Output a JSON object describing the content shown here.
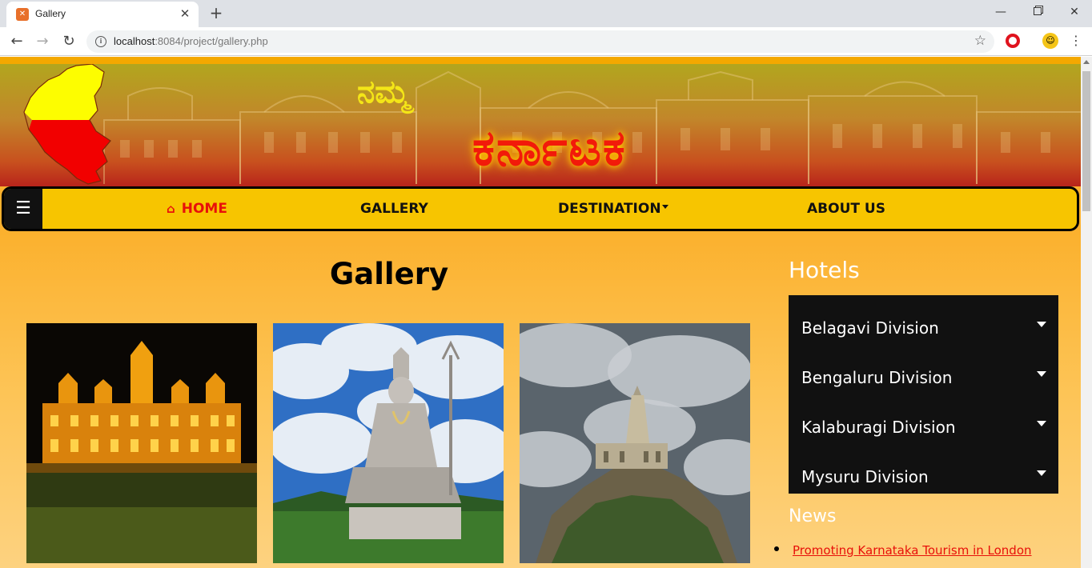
{
  "browser": {
    "tab_title": "Gallery",
    "tab_favicon": "xampp-icon",
    "url_host": "localhost",
    "url_rest": ":8084/project/gallery.php"
  },
  "site": {
    "logo_small": "ನಮ್ಮ",
    "logo_big": "ಕರ್ನಾಟಕ",
    "colors": {
      "nav_bg": "#f7c500",
      "active": "#e8100a",
      "page_bg": "#fbb12e",
      "panel": "#111111"
    }
  },
  "nav": {
    "menu_icon": "☰",
    "home": "HOME",
    "gallery": "GALLERY",
    "destination": "DESTINATION",
    "about": "ABOUT US"
  },
  "main": {
    "heading": "Gallery",
    "photos": [
      "mysore-palace-night",
      "lord-shiva-statue-murudeshwar",
      "hilltop-temple-cloudy-sky"
    ]
  },
  "sidebar": {
    "hotels_heading": "Hotels",
    "divisions": [
      "Belagavi Division",
      "Bengaluru Division",
      "Kalaburagi Division",
      "Mysuru Division"
    ],
    "news_heading": "News",
    "news_items": [
      "Promoting Karnataka Tourism in London"
    ]
  }
}
